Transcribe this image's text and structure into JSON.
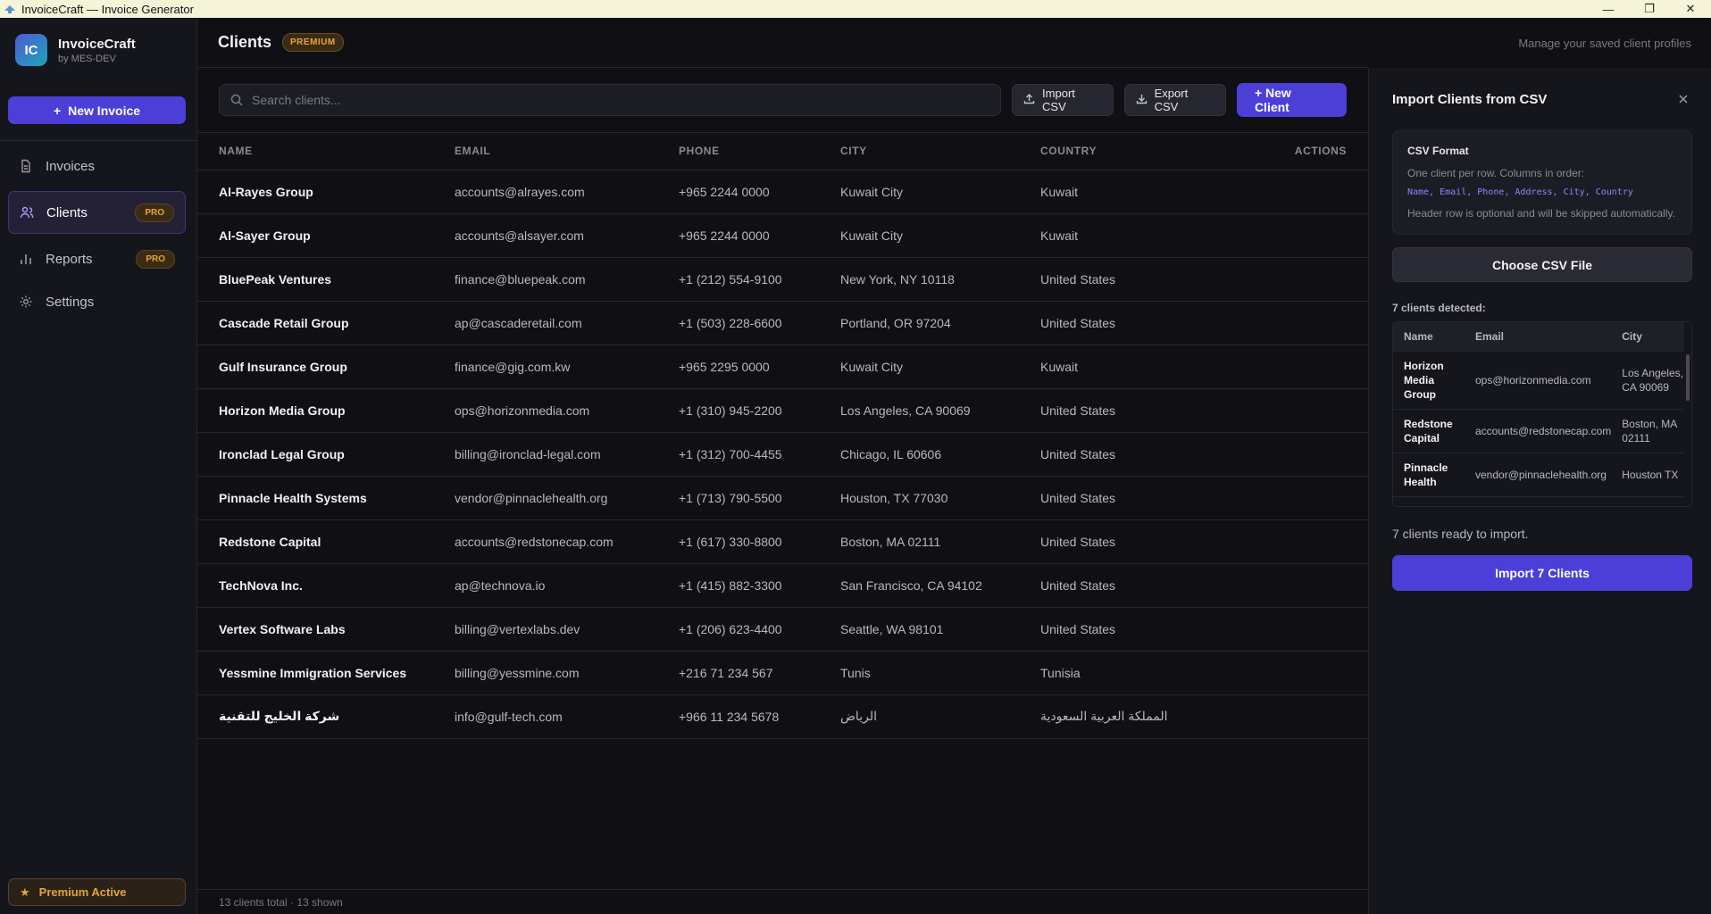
{
  "window": {
    "title": "InvoiceCraft — Invoice Generator",
    "minimize": "—",
    "maximize": "❐",
    "close": "✕"
  },
  "brand": {
    "logo": "IC",
    "name": "InvoiceCraft",
    "sub": "by MES-DEV"
  },
  "sidebar": {
    "new_invoice": "New Invoice",
    "items": [
      {
        "label": "Invoices",
        "icon": "document-icon",
        "badge": ""
      },
      {
        "label": "Clients",
        "icon": "users-icon",
        "badge": "PRO",
        "active": true
      },
      {
        "label": "Reports",
        "icon": "bar-chart-icon",
        "badge": "PRO"
      },
      {
        "label": "Settings",
        "icon": "gear-icon",
        "badge": ""
      }
    ],
    "premium": "Premium Active"
  },
  "header": {
    "title": "Clients",
    "badge": "PREMIUM",
    "subtitle": "Manage your saved client profiles"
  },
  "toolbar": {
    "search_placeholder": "Search clients...",
    "import": "Import CSV",
    "export": "Export CSV",
    "new_client": "+ New Client"
  },
  "table": {
    "columns": [
      "NAME",
      "EMAIL",
      "PHONE",
      "CITY",
      "COUNTRY",
      "ACTIONS"
    ],
    "rows": [
      [
        "Al-Rayes Group",
        "accounts@alrayes.com",
        "+965 2244 0000",
        "Kuwait City",
        "Kuwait"
      ],
      [
        "Al-Sayer Group",
        "accounts@alsayer.com",
        "+965 2244 0000",
        "Kuwait City",
        "Kuwait"
      ],
      [
        "BluePeak Ventures",
        "finance@bluepeak.com",
        "+1 (212) 554-9100",
        "New York, NY 10118",
        "United States"
      ],
      [
        "Cascade Retail Group",
        "ap@cascaderetail.com",
        "+1 (503) 228-6600",
        "Portland, OR 97204",
        "United States"
      ],
      [
        "Gulf Insurance Group",
        "finance@gig.com.kw",
        "+965 2295 0000",
        "Kuwait City",
        "Kuwait"
      ],
      [
        "Horizon Media Group",
        "ops@horizonmedia.com",
        "+1 (310) 945-2200",
        "Los Angeles, CA 90069",
        "United States"
      ],
      [
        "Ironclad Legal Group",
        "billing@ironclad-legal.com",
        "+1 (312) 700-4455",
        "Chicago, IL 60606",
        "United States"
      ],
      [
        "Pinnacle Health Systems",
        "vendor@pinnaclehealth.org",
        "+1 (713) 790-5500",
        "Houston, TX 77030",
        "United States"
      ],
      [
        "Redstone Capital",
        "accounts@redstonecap.com",
        "+1 (617) 330-8800",
        "Boston, MA 02111",
        "United States"
      ],
      [
        "TechNova Inc.",
        "ap@technova.io",
        "+1 (415) 882-3300",
        "San Francisco, CA 94102",
        "United States"
      ],
      [
        "Vertex Software Labs",
        "billing@vertexlabs.dev",
        "+1 (206) 623-4400",
        "Seattle, WA 98101",
        "United States"
      ],
      [
        "Yessmine Immigration Services",
        "billing@yessmine.com",
        "+216 71 234 567",
        "Tunis",
        "Tunisia"
      ],
      [
        "شركة الخليج للتقنية",
        "info@gulf-tech.com",
        "+966 11 234 5678",
        "الرياض",
        "المملكة العربية السعودية"
      ]
    ],
    "footer": "13 clients total · 13 shown"
  },
  "panel": {
    "title": "Import Clients from CSV",
    "format_title": "CSV Format",
    "format_desc": "One client per row. Columns in order:",
    "format_cols": "Name, Email, Phone, Address, City, Country",
    "format_note": "Header row is optional and will be skipped automatically.",
    "choose": "Choose CSV File",
    "detected": "7 clients detected:",
    "preview_cols": [
      "Name",
      "Email",
      "City"
    ],
    "preview_rows": [
      [
        "Horizon Media Group",
        "ops@horizonmedia.com",
        "Los Angeles, CA 90069"
      ],
      [
        "Redstone Capital",
        "accounts@redstonecap.com",
        "Boston, MA 02111"
      ],
      [
        "Pinnacle Health",
        "vendor@pinnaclehealth.org",
        "Houston TX"
      ]
    ],
    "ready": "7 clients ready to import.",
    "import": "Import 7 Clients"
  },
  "colors": {
    "accent": "#4b3fd8",
    "gold": "#e6a43a",
    "bg": "#0f0f14"
  }
}
